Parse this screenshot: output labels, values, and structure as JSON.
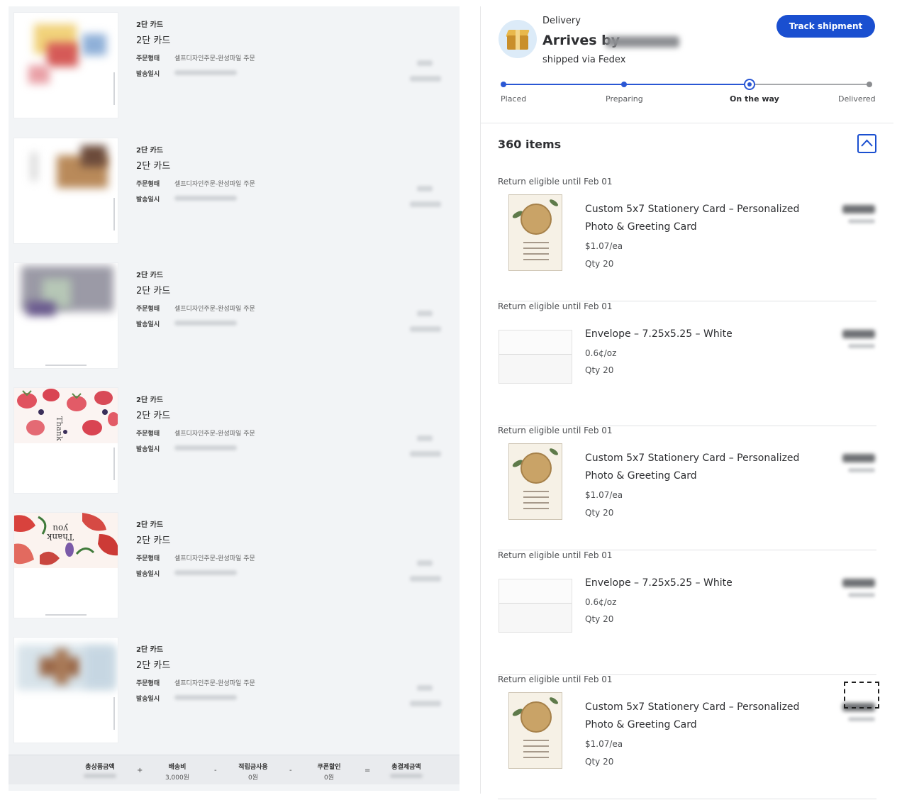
{
  "left_panel": {
    "items": [
      {
        "type_small": "2단 카드",
        "title": "2단 카드",
        "order_type_label": "주문형태",
        "order_type_value": "셀프디자인주문-완성파일 주문",
        "ship_date_label": "발송일시"
      },
      {
        "type_small": "2단 카드",
        "title": "2단 카드",
        "order_type_label": "주문형태",
        "order_type_value": "셀프디자인주문-완성파일 주문",
        "ship_date_label": "발송일시"
      },
      {
        "type_small": "2단 카드",
        "title": "2단 카드",
        "order_type_label": "주문형태",
        "order_type_value": "셀프디자인주문-완성파일 주문",
        "ship_date_label": "발송일시"
      },
      {
        "type_small": "2단 카드",
        "title": "2단 카드",
        "order_type_label": "주문형태",
        "order_type_value": "셀프디자인주문-완성파일 주문",
        "ship_date_label": "발송일시"
      },
      {
        "type_small": "2단 카드",
        "title": "2단 카드",
        "order_type_label": "주문형태",
        "order_type_value": "셀프디자인주문-완성파일 주문",
        "ship_date_label": "발송일시"
      },
      {
        "type_small": "2단 카드",
        "title": "2단 카드",
        "order_type_label": "주문형태",
        "order_type_value": "셀프디자인주문-완성파일 주문",
        "ship_date_label": "발송일시"
      }
    ],
    "summary": {
      "total_products_label": "총상품금액",
      "op_plus": "+",
      "shipping_label": "배송비",
      "shipping_value": "3,000원",
      "op_minus1": "-",
      "points_label": "적립금사용",
      "points_value": "0원",
      "op_minus2": "-",
      "coupon_label": "쿠폰할인",
      "coupon_value": "0원",
      "op_equals": "=",
      "total_payment_label": "총결제금액"
    }
  },
  "right_panel": {
    "delivery_label": "Delivery",
    "arrives_label": "Arrives by",
    "shipped_via": "shipped via Fedex",
    "track_button": "Track shipment",
    "steps": [
      "Placed",
      "Preparing",
      "On the way",
      "Delivered"
    ],
    "current_step": "On the way",
    "items_count": "360 items",
    "products": [
      {
        "return_note": "Return eligible until Feb 01",
        "name": "Custom 5x7 Stationery Card – Personalized Photo & Greeting Card",
        "unit_price": "$1.07/ea",
        "qty": "Qty 20",
        "kind": "card"
      },
      {
        "return_note": "Return eligible until Feb 01",
        "name": "Envelope – 7.25x5.25 – White",
        "unit_price": "0.6¢/oz",
        "qty": "Qty 20",
        "kind": "envelope"
      },
      {
        "return_note": "Return eligible until Feb 01",
        "name": "Custom 5x7 Stationery Card – Personalized Photo & Greeting Card",
        "unit_price": "$1.07/ea",
        "qty": "Qty 20",
        "kind": "card"
      },
      {
        "return_note": "Return eligible until Feb 01",
        "name": "Envelope – 7.25x5.25 – White",
        "unit_price": "0.6¢/oz",
        "qty": "Qty 20",
        "kind": "envelope"
      },
      {
        "return_note": "Return eligible until Feb 01",
        "name": "Custom 5x7 Stationery Card – Personalized Photo & Greeting Card",
        "unit_price": "$1.07/ea",
        "qty": "Qty 20",
        "kind": "card"
      }
    ],
    "colors": {
      "accent": "#1a4fd0",
      "progress_done": "#2a57d4",
      "progress_pending": "#a7a9ac"
    }
  }
}
